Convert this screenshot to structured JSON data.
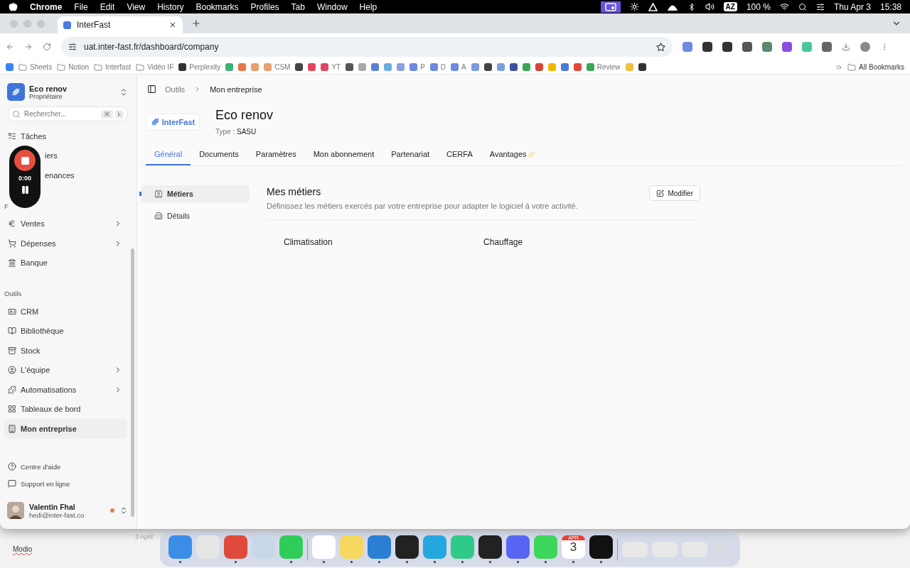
{
  "menu_bar": {
    "app": "Chrome",
    "menus": [
      "File",
      "Edit",
      "View",
      "History",
      "Bookmarks",
      "Profiles",
      "Tab",
      "Window",
      "Help"
    ],
    "keyboard_layout": "AZ",
    "battery": "100 %",
    "date": "Thu Apr 3",
    "time": "15:38"
  },
  "browser": {
    "tab": {
      "title": "InterFast"
    },
    "url": "uat.inter-fast.fr/dashboard/company",
    "extensions": [
      {
        "color": "#6b8ae0"
      },
      {
        "color": "#333333"
      },
      {
        "color": "#333333"
      },
      {
        "color": "#555555"
      },
      {
        "color": "#5a8a70"
      },
      {
        "color": "#8b4de0"
      },
      {
        "color": "#4cc79a"
      },
      {
        "color": "#666666"
      }
    ],
    "bookmarks": [
      {
        "kind": "site",
        "color": "#3b82f6"
      },
      {
        "kind": "folder",
        "label": "Sheets"
      },
      {
        "kind": "folder",
        "label": "Notion"
      },
      {
        "kind": "folder",
        "label": "Interfast"
      },
      {
        "kind": "folder",
        "label": "Vidéo IF"
      },
      {
        "kind": "site",
        "color": "#333333",
        "label": "Perplexity"
      },
      {
        "kind": "site",
        "color": "#3fb07a"
      },
      {
        "kind": "site",
        "color": "#e8734a"
      },
      {
        "kind": "site",
        "color": "#e8a070"
      },
      {
        "kind": "site",
        "color": "#e8a070",
        "label": "CSM"
      },
      {
        "kind": "site",
        "color": "#444444"
      },
      {
        "kind": "site",
        "color": "#e0475f"
      },
      {
        "kind": "site",
        "color": "#e0475f",
        "label": "YT"
      },
      {
        "kind": "site",
        "color": "#555555"
      },
      {
        "kind": "site",
        "color": "#aaaaaa"
      },
      {
        "kind": "site",
        "color": "#5a7fd6"
      },
      {
        "kind": "site",
        "color": "#6aaee0"
      },
      {
        "kind": "site",
        "color": "#8aa0e0"
      },
      {
        "kind": "site",
        "color": "#6b8ae0",
        "label": "P"
      },
      {
        "kind": "site",
        "color": "#6b8ae0",
        "label": "D"
      },
      {
        "kind": "site",
        "color": "#6b8ae0",
        "label": "A"
      },
      {
        "kind": "site",
        "color": "#7a9ae0"
      },
      {
        "kind": "site",
        "color": "#444444"
      },
      {
        "kind": "site",
        "color": "#7aa0e0"
      },
      {
        "kind": "site",
        "color": "#3c4fa0"
      },
      {
        "kind": "site",
        "color": "#34a853"
      },
      {
        "kind": "site",
        "color": "#d94435"
      },
      {
        "kind": "site",
        "color": "#f4b400"
      },
      {
        "kind": "site",
        "color": "#4a7ae0"
      },
      {
        "kind": "site",
        "color": "#e04a3a"
      },
      {
        "kind": "site",
        "color": "#34a853",
        "label": "Review"
      },
      {
        "kind": "site",
        "color": "#f0c040"
      },
      {
        "kind": "site",
        "color": "#333333"
      }
    ],
    "all_bookmarks": "All Bookmarks"
  },
  "sidebar": {
    "company": {
      "name": "Eco renov",
      "role": "Propriétaire"
    },
    "search": {
      "placeholder": "Rechercher...",
      "shortcut": [
        "⌘",
        "k"
      ]
    },
    "groups": [
      {
        "items": [
          {
            "label": "Tâches",
            "expandable": false,
            "selected": false
          },
          {
            "label": "iers",
            "expandable": false,
            "selected": false
          },
          {
            "label": "enances",
            "expandable": false,
            "selected": false
          }
        ]
      },
      {
        "label": "F",
        "items": [
          {
            "label": "Ventes",
            "expandable": true,
            "selected": false
          },
          {
            "label": "Dépenses",
            "expandable": true,
            "selected": false
          },
          {
            "label": "Banque",
            "expandable": false,
            "selected": false
          }
        ]
      },
      {
        "label": "Outils",
        "items": [
          {
            "label": "CRM",
            "expandable": false,
            "selected": false
          },
          {
            "label": "Bibliothèque",
            "expandable": false,
            "selected": false
          },
          {
            "label": "Stock",
            "expandable": false,
            "selected": false
          },
          {
            "label": "L'équipe",
            "expandable": true,
            "selected": false
          },
          {
            "label": "Automatisations",
            "expandable": true,
            "selected": false
          },
          {
            "label": "Tableaux de bord",
            "expandable": false,
            "selected": false
          },
          {
            "label": "Mon entreprise",
            "expandable": false,
            "selected": true
          }
        ]
      }
    ],
    "footer_links": [
      "Centre d'aide",
      "Support en ligne"
    ],
    "user": {
      "name": "Valentin Fhal",
      "email": "hedi@inter-fast.co"
    }
  },
  "recording": {
    "elapsed": "0:00"
  },
  "breadcrumb": [
    "Outils",
    "Mon entreprise"
  ],
  "company": {
    "logo": "InterFast",
    "name": "Eco renov",
    "type": "Type : **SASU**"
  },
  "tabs": [
    {
      "label": "Général",
      "selected": true
    },
    {
      "label": "Documents",
      "selected": false
    },
    {
      "label": "Paramètres",
      "selected": false
    },
    {
      "label": "Mon abonnement",
      "selected": false
    },
    {
      "label": "Partenariat",
      "selected": false
    },
    {
      "label": "CERFA",
      "selected": false
    },
    {
      "label": "Avantages",
      "selected": false
    }
  ],
  "subnav": [
    {
      "label": "Métiers",
      "selected": true
    },
    {
      "label": "Détails",
      "selected": false
    }
  ],
  "section": {
    "title": "Mes métiers",
    "description": "Définissez les métiers exercés par votre entreprise pour adapter le logiciel à votre activité.",
    "edit_button": "Modifier",
    "trades": [
      "Climatisation",
      "Chauffage"
    ]
  },
  "desktop": {
    "behind_window": "Modio",
    "date": "3 April"
  },
  "dock": [
    {
      "color": "#3a8ee6",
      "running": true
    },
    {
      "color": "#e6e6e6",
      "running": false
    },
    {
      "color": "#e04a3a",
      "running": true
    },
    {
      "color": "#c9d8e8",
      "running": false
    },
    {
      "color": "#2fcc5a",
      "running": true
    },
    {
      "color": "#ffffff",
      "running": true
    },
    {
      "color": "#f6d860",
      "running": true
    },
    {
      "color": "#2a7fd4",
      "running": true
    },
    {
      "color": "#222222",
      "running": true
    },
    {
      "color": "#24a8e0",
      "running": true
    },
    {
      "color": "#2fc98a",
      "running": true
    },
    {
      "color": "#222222",
      "running": true
    },
    {
      "color": "#5865f2",
      "running": true
    },
    {
      "color": "#3cd65a",
      "running": true
    },
    {
      "kind": "calendar",
      "month": "APR",
      "day": "3",
      "running": true
    },
    {
      "color": "#111111",
      "running": true
    }
  ]
}
